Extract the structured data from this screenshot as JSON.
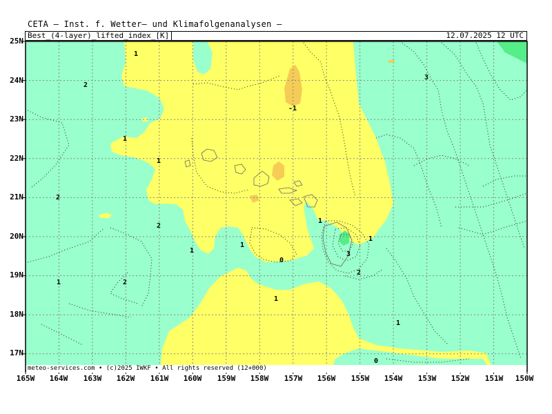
{
  "header": {
    "institute": "CETA — Inst. f. Wetter— und Klimafolgenanalysen —",
    "parameter": "Best_(4-layer)_lifted_index_[K]",
    "datetime": "12.07.2025 12 UTC"
  },
  "footer": "meteo-services.com • (c)2025 IWKF • All rights reserved (12+000)",
  "axes": {
    "lat_labels": [
      "25N",
      "24N",
      "23N",
      "22N",
      "21N",
      "20N",
      "19N",
      "18N",
      "17N"
    ],
    "lon_labels": [
      "165W",
      "164W",
      "163W",
      "162W",
      "161W",
      "160W",
      "159W",
      "158W",
      "157W",
      "156W",
      "155W",
      "154W",
      "153W",
      "152W",
      "151W",
      "150W"
    ]
  },
  "contour_labels": [
    {
      "text": "1"
    },
    {
      "text": "2"
    },
    {
      "text": "-1"
    },
    {
      "text": "3"
    },
    {
      "text": "1"
    },
    {
      "text": "1"
    },
    {
      "text": "2"
    },
    {
      "text": "2"
    },
    {
      "text": "1"
    },
    {
      "text": "1"
    },
    {
      "text": "1"
    },
    {
      "text": "0"
    },
    {
      "text": "1"
    },
    {
      "text": "3"
    },
    {
      "text": "2"
    },
    {
      "text": "1"
    },
    {
      "text": "2"
    },
    {
      "text": "1"
    },
    {
      "text": "1"
    },
    {
      "text": "0"
    }
  ],
  "legend_colors": {
    "stable": "#99ffcc",
    "neutral": "#ffff66",
    "unstable": "#f5cc55",
    "strong_stable": "#55ee88"
  }
}
